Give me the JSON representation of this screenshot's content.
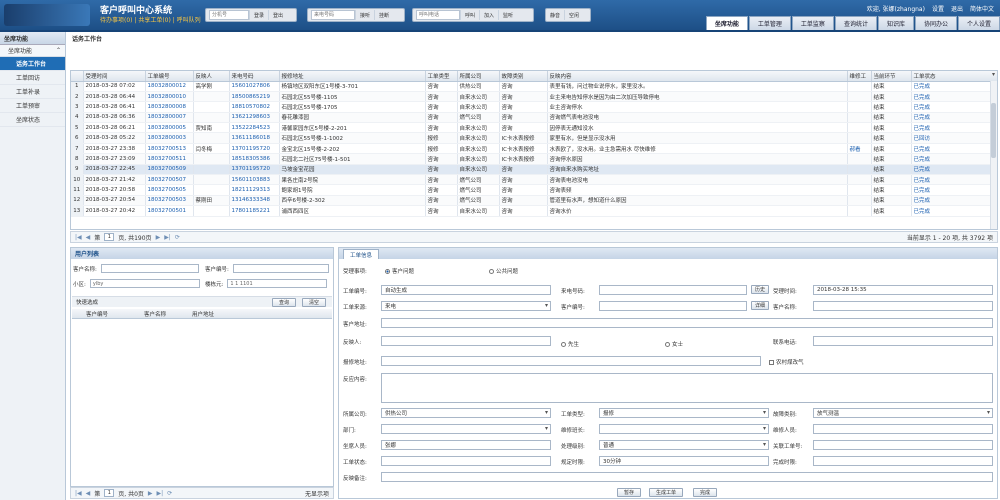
{
  "header": {
    "title": "客户呼叫中心系统",
    "subtitle": "待办事项(0) | 共享工单(0) | 呼叫队列",
    "agent": {
      "placeholder": "分机号",
      "login": "登录",
      "logout": "登出"
    },
    "call": {
      "placeholder": "来电号码",
      "answer": "接听",
      "hangup": "挂断"
    },
    "outbound": {
      "placeholder": "呼叫电话",
      "dial": "呼叫",
      "join": "加入",
      "monitor": "监听"
    },
    "status": {
      "mute": "静音",
      "idle": "空闲"
    },
    "user": {
      "welcome": "欢迎, 张娜(zhangna)",
      "settings": "设置",
      "exit": "退出",
      "lang": "简体中文"
    },
    "tabs": [
      "坐席功能",
      "工单管理",
      "工单监察",
      "查询统计",
      "知识库",
      "协同办公",
      "个人设置"
    ]
  },
  "sidebar": {
    "header": "坐席功能",
    "group": "坐席功能",
    "items": [
      "话务工作台",
      "工单回访",
      "工单补录",
      "工单预审",
      "坐席状态"
    ]
  },
  "work_title": "话务工作台",
  "grid": {
    "columns": [
      "受理时间",
      "工单编号",
      "反映人",
      "来电号码",
      "报修地址",
      "工单类型",
      "所属公司",
      "故障类别",
      "反映内容",
      "维修工",
      "当前环节",
      "工单状态"
    ],
    "rows": [
      [
        "1",
        "2018-03-28 07:02",
        "18032800012",
        "高学刚",
        "15601027806",
        "杨镇地区双阳东区1号楼-3-701",
        "咨询",
        "供热公司",
        "咨询",
        "表里有钱，问过物业说停水，家里没水。",
        "",
        "结束",
        "已完成"
      ],
      [
        "2",
        "2018-03-28 06:44",
        "18032800010",
        "",
        "18500865219",
        "石园北区55号楼-1105",
        "咨询",
        "自来水公司",
        "咨询",
        "业主来电告知停水是因为由二次加压导致停电",
        "",
        "结束",
        "已完成"
      ],
      [
        "3",
        "2018-03-28 06:41",
        "18032800008",
        "",
        "18810570802",
        "石园北区55号楼-1705",
        "咨询",
        "自来水公司",
        "咨询",
        "业主咨询停水",
        "",
        "结束",
        "已完成"
      ],
      [
        "4",
        "2018-03-28 06:36",
        "18032800007",
        "",
        "13621298603",
        "春花雕漆园",
        "咨询",
        "燃气公司",
        "咨询",
        "咨询燃气表电池没电",
        "",
        "结束",
        "已完成"
      ],
      [
        "5",
        "2018-03-28 06:21",
        "18032800005",
        "贾知南",
        "13522284523",
        "港馨家园东区5号楼-2-201",
        "咨询",
        "自来水公司",
        "咨询",
        "因停表无通知没水",
        "",
        "结束",
        "已完成"
      ],
      [
        "6",
        "2018-03-28 05:22",
        "18032800003",
        "",
        "13611186018",
        "石园北区55号楼-1-1002",
        "报修",
        "自来水公司",
        "IC卡水表报修",
        "家里有水，但是显示没水用",
        "",
        "结束",
        "已回访"
      ],
      [
        "7",
        "2018-03-27 23:38",
        "18032700513",
        "闫冬梅",
        "13701195720",
        "金宝北区15号楼-2-202",
        "报修",
        "自来水公司",
        "IC卡水表报修",
        "水表欧了，没水用。业主急需用水 尽快维修",
        "郝看",
        "结束",
        "已完成"
      ],
      [
        "8",
        "2018-03-27 23:09",
        "18032700511",
        "",
        "18518305386",
        "石园北二社区75号楼-1-501",
        "咨询",
        "自来水公司",
        "IC卡水表报修",
        "咨询停水原因",
        "",
        "结束",
        "已完成"
      ],
      [
        "9",
        "2018-03-27 22:45",
        "18032700509",
        "",
        "13701195720",
        "马坡金宝花园",
        "咨询",
        "自来水公司",
        "咨询",
        "咨询自来水购买地址",
        "",
        "结束",
        "已完成"
      ],
      [
        "10",
        "2018-03-27 21:42",
        "18032700507",
        "",
        "15601103883",
        "果各庄南2号院",
        "咨询",
        "燃气公司",
        "咨询",
        "咨询表电池没电",
        "",
        "结束",
        "已完成"
      ],
      [
        "11",
        "2018-03-27 20:58",
        "18032700505",
        "",
        "18211129313",
        "鲍家胡1号院",
        "咨询",
        "燃气公司",
        "咨询",
        "咨询表频",
        "",
        "结束",
        "已完成"
      ],
      [
        "12",
        "2018-03-27 20:54",
        "18032700503",
        "蔡刚田",
        "13146333348",
        "西辛6号楼-2-302",
        "咨询",
        "燃气公司",
        "咨询",
        "管道里有水声，想知道什么原因",
        "",
        "结束",
        "已完成"
      ],
      [
        "13",
        "2018-03-27 20:42",
        "18032700501",
        "",
        "17801185221",
        "浦西西四区",
        "咨询",
        "自来水公司",
        "咨询",
        "咨询水价",
        "",
        "结束",
        "已完成"
      ]
    ]
  },
  "pager1": {
    "page_label": "第",
    "page": "1",
    "total_pages": "页, 共190页",
    "display": "当前显示 1 - 20 项, 共 3792 项"
  },
  "user_list": {
    "title": "用户列表",
    "customer_name_label": "客户名称:",
    "customer_no_label": "客户编号:",
    "district_label": "小区:",
    "district_value": "ylby",
    "building_label": "楼栋元:",
    "building_value": "1 1 1101",
    "quick_select": "快速选成",
    "query_btn": "查询",
    "clear_btn": "清空",
    "columns": [
      "客户编号",
      "客户名称",
      "用户地址"
    ]
  },
  "pager2": {
    "page_label": "第",
    "page": "1",
    "total_pages": "页, 共0页",
    "display": "无显示项"
  },
  "ticket": {
    "tab": "工单信息",
    "type_label": "受理事项:",
    "opt_customer": "客户问题",
    "opt_public": "公共问题",
    "ticket_no_label": "工单编号:",
    "ticket_no_value": "自动生成",
    "caller_label": "来电号码:",
    "history_btn": "历史",
    "accept_time_label": "受理时间:",
    "accept_time_value": "2018-03-28 15:35",
    "source_label": "工单来源:",
    "source_value": "来电",
    "customer_no_label": "客户编号:",
    "detail_btn": "详细",
    "customer_name_label": "客户名称:",
    "customer_addr_label": "客户地址:",
    "reporter_label": "反映人:",
    "male": "先生",
    "female": "女士",
    "contact_label": "联系电话:",
    "repair_addr_label": "报修地址:",
    "rural_gas": "农村煤改气",
    "content_label": "反应内容:",
    "company_label": "所属公司:",
    "company_value": "供热公司",
    "ticket_type_label": "工单类型:",
    "ticket_type_value": "报修",
    "fault_label": "故障类别:",
    "fault_value": "放气测温",
    "dept_label": "部门:",
    "leader_label": "维修班长:",
    "repairer_label": "维修人员:",
    "agent_label": "坐席人员:",
    "agent_value": "张娜",
    "level_label": "处理级别:",
    "level_value": "普通",
    "related_label": "关联工单号:",
    "status_label": "工单状态:",
    "deadline_label": "规定时限:",
    "deadline_value": "30分钟",
    "finish_label": "完成时限:",
    "feedback_label": "反映备注:",
    "save_btn": "暂存",
    "create_btn": "生成工单",
    "done_btn": "完成"
  }
}
